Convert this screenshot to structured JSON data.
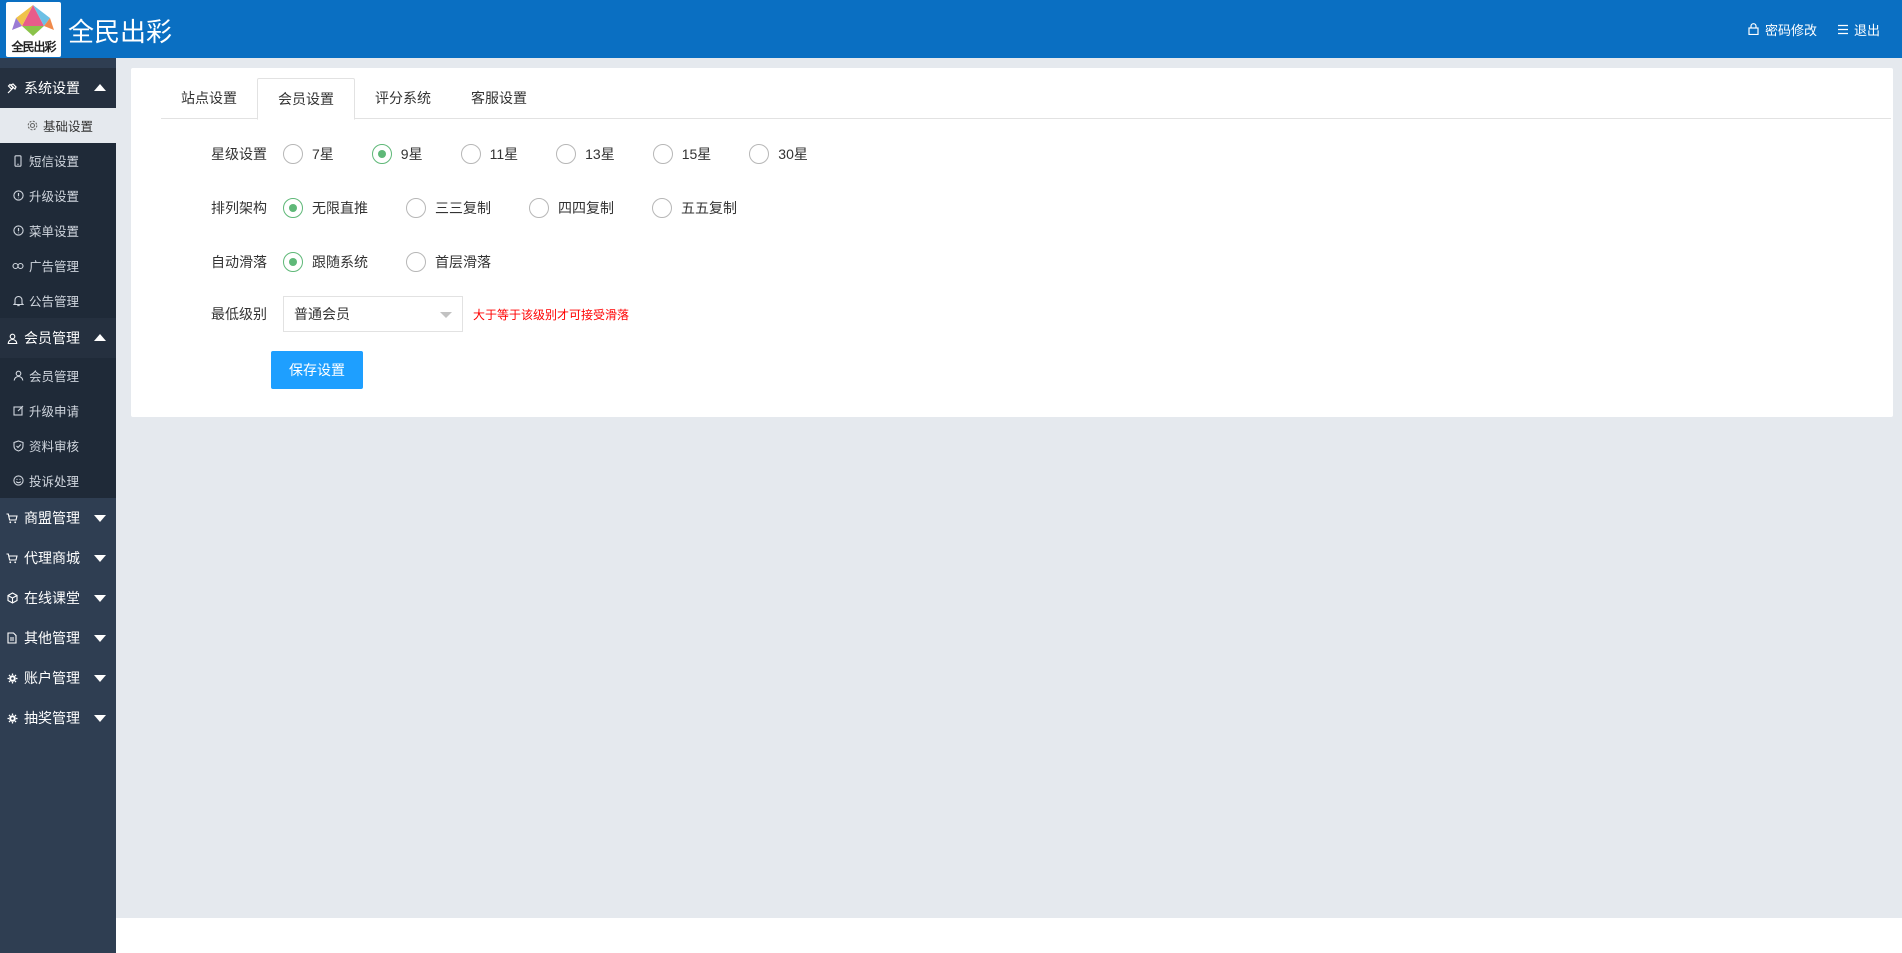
{
  "colors": {
    "header_bg": "#0a6fc2",
    "sidebar_bg": "#2f3e52",
    "radio_checked": "#5fb878",
    "primary_button": "#1e9fff",
    "hint_text": "#ff0000"
  },
  "header": {
    "logo_text": "全民出彩",
    "title": "全民出彩",
    "actions": [
      {
        "label": "密码修改",
        "icon": "lock-icon"
      },
      {
        "label": "退出",
        "icon": "menu-lines-icon"
      }
    ]
  },
  "sidebar": {
    "groups": [
      {
        "label": "系统设置",
        "icon": "tools-icon",
        "expanded": true,
        "items": [
          {
            "label": "基础设置",
            "icon": "gear-icon",
            "active": true
          },
          {
            "label": "短信设置",
            "icon": "phone-icon"
          },
          {
            "label": "升级设置",
            "icon": "info-circle-icon"
          },
          {
            "label": "菜单设置",
            "icon": "info-circle-icon"
          },
          {
            "label": "广告管理",
            "icon": "link-icon"
          },
          {
            "label": "公告管理",
            "icon": "bell-icon"
          }
        ]
      },
      {
        "label": "会员管理",
        "icon": "user-icon",
        "expanded": true,
        "items": [
          {
            "label": "会员管理",
            "icon": "user-icon"
          },
          {
            "label": "升级申请",
            "icon": "edit-icon"
          },
          {
            "label": "资料审核",
            "icon": "shield-icon"
          },
          {
            "label": "投诉处理",
            "icon": "smile-icon"
          }
        ]
      },
      {
        "label": "商盟管理",
        "icon": "cart-icon",
        "expanded": false
      },
      {
        "label": "代理商城",
        "icon": "cart-icon",
        "expanded": false
      },
      {
        "label": "在线课堂",
        "icon": "cube-icon",
        "expanded": false
      },
      {
        "label": "其他管理",
        "icon": "document-icon",
        "expanded": false
      },
      {
        "label": "账户管理",
        "icon": "gear-icon",
        "expanded": false
      },
      {
        "label": "抽奖管理",
        "icon": "gear-icon",
        "expanded": false
      }
    ]
  },
  "tabs": [
    {
      "label": "站点设置",
      "active": false
    },
    {
      "label": "会员设置",
      "active": true
    },
    {
      "label": "评分系统",
      "active": false
    },
    {
      "label": "客服设置",
      "active": false
    }
  ],
  "form": {
    "star_level": {
      "label": "星级设置",
      "options": [
        "7星",
        "9星",
        "11星",
        "13星",
        "15星",
        "30星"
      ],
      "selected": "9星"
    },
    "arrangement": {
      "label": "排列架构",
      "options": [
        "无限直推",
        "三三复制",
        "四四复制",
        "五五复制"
      ],
      "selected": "无限直推"
    },
    "auto_slide": {
      "label": "自动滑落",
      "options": [
        "跟随系统",
        "首层滑落"
      ],
      "selected": "跟随系统"
    },
    "min_level": {
      "label": "最低级别",
      "value": "普通会员",
      "hint": "大于等于该级别才可接受滑落"
    },
    "save_label": "保存设置"
  }
}
